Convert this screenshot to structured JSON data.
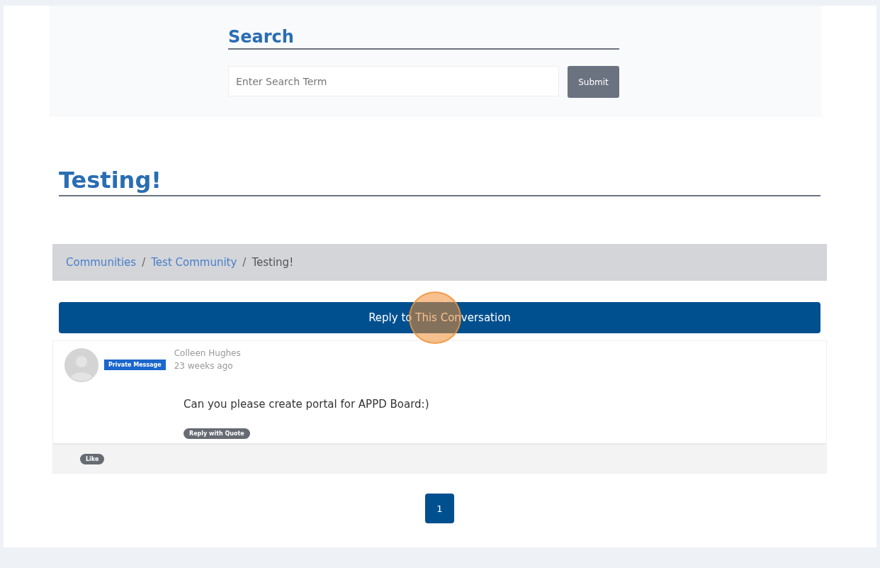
{
  "search": {
    "title": "Search",
    "placeholder": "Enter Search Term",
    "submit": "Submit"
  },
  "topic": {
    "title": "Testing!"
  },
  "breadcrumb_separator": "/",
  "breadcrumb": [
    {
      "label": "Communities",
      "kind": "link"
    },
    {
      "label": "Test Community",
      "kind": "link"
    },
    {
      "label": "Testing!",
      "kind": "current"
    }
  ],
  "reply_button": "Reply to This Conversation",
  "posts": [
    {
      "badge": "Private Message",
      "author": "Colleen Hughes",
      "time": "23 weeks ago",
      "body": "Can you please create portal for APPD Board:)",
      "quote_button": "Reply with Quote",
      "like_button": "Like"
    }
  ],
  "pagination": [
    {
      "label": "1",
      "selected": true
    }
  ]
}
